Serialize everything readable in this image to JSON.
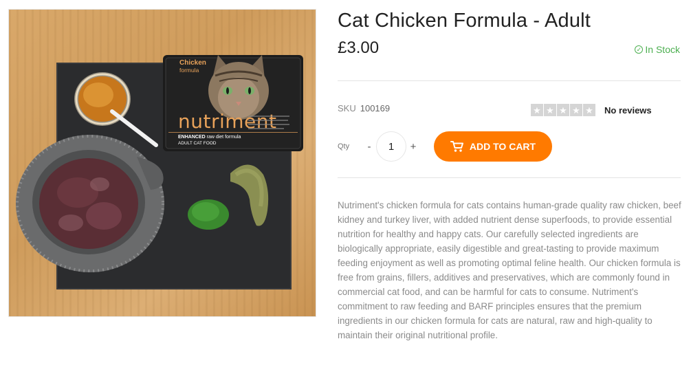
{
  "product": {
    "title": "Cat Chicken Formula - Adult",
    "price": "£3.00",
    "stock_status": "In Stock",
    "sku_label": "SKU",
    "sku_value": "100169",
    "rating": {
      "stars_filled": 0,
      "stars_total": 5,
      "reviews_text": "No reviews"
    },
    "qty_label": "Qty",
    "qty_value": "1",
    "qty_minus": "-",
    "qty_plus": "+",
    "add_to_cart_label": "ADD TO CART",
    "description": "Nutriment's chicken formula for cats contains human-grade quality raw chicken, beef kidney and turkey liver, with added nutrient dense superfoods, to provide essential nutrition for healthy and happy cats. Our carefully selected ingredients are biologically appropriate, easily digestible and great-tasting to provide maximum feeding enjoyment as well as promoting optimal feline health. Our chicken formula is free from grains, fillers, additives and preservatives, which are commonly found in commercial cat food, and can be harmful for cats to consume. Nutriment's commitment to raw feeding and BARF principles ensures that the premium ingredients in our chicken formula for cats are natural, raw and high-quality to maintain their original nutritional profile."
  },
  "image": {
    "pack_flavor": "Chicken",
    "pack_flavor_sub": "formula",
    "pack_brand": "nutriment",
    "pack_line1": "ENHANCED",
    "pack_line1_rest": " raw diet formula",
    "pack_line2": "ADULT CAT FOOD"
  },
  "icons": {
    "stock": "check-circle-icon",
    "cart": "cart-icon",
    "star": "star-icon"
  },
  "colors": {
    "accent": "#ff7a00",
    "in_stock": "#4caf50",
    "star_empty": "#d5d5d5",
    "muted_text": "#8a8a8a"
  }
}
